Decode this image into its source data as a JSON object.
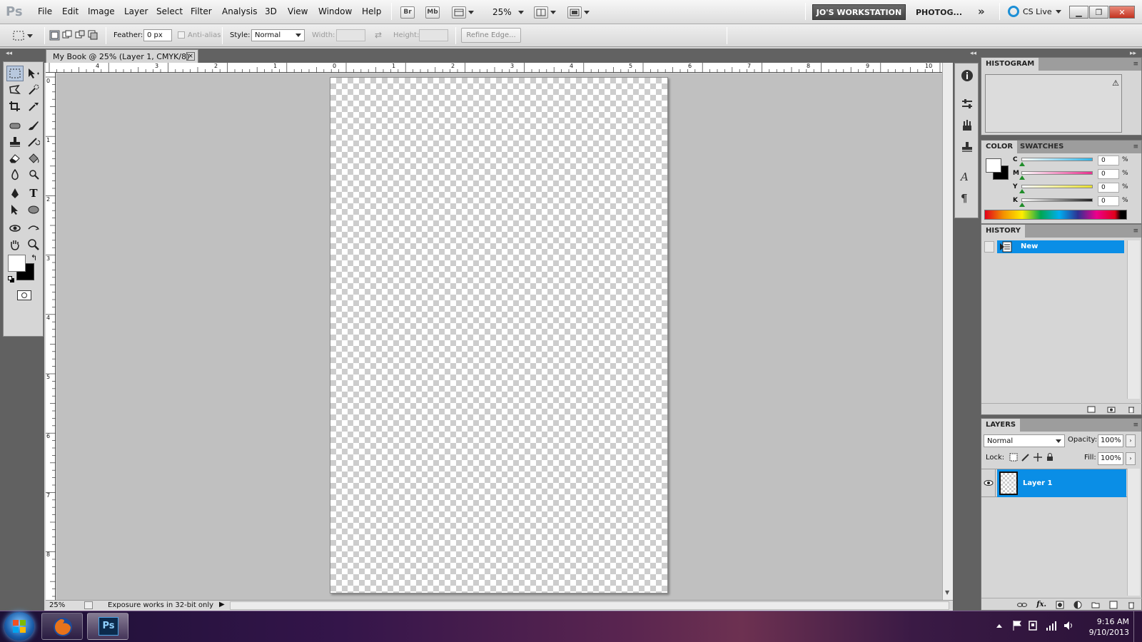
{
  "menubar": {
    "app_icon": "Ps",
    "items": [
      "File",
      "Edit",
      "Image",
      "Layer",
      "Select",
      "Filter",
      "Analysis",
      "3D",
      "View",
      "Window",
      "Help"
    ],
    "bridge_label": "Br",
    "minibridge_label": "Mb",
    "zoom": "25%",
    "workspace": "JO'S WORKSTATION",
    "workspace_alt": "PHOTOG...",
    "more": "»",
    "cs_live": "CS Live"
  },
  "options": {
    "feather_label": "Feather:",
    "feather_value": "0 px",
    "antialias_label": "Anti-alias",
    "style_label": "Style:",
    "style_value": "Normal",
    "width_label": "Width:",
    "height_label": "Height:",
    "refine_edge": "Refine Edge..."
  },
  "document": {
    "tab_title": "My Book @ 25% (Layer 1, CMYK/8)",
    "close_glyph": "×",
    "ruler_h_labels": [
      "4",
      "3",
      "2",
      "1",
      "0",
      "1",
      "2",
      "3",
      "4",
      "5",
      "6",
      "7",
      "8",
      "9",
      "10"
    ],
    "ruler_v_labels": [
      "0",
      "1",
      "2",
      "3",
      "4",
      "5",
      "6",
      "7",
      "8"
    ]
  },
  "status": {
    "zoom": "25%",
    "message": "Exposure works in 32-bit only"
  },
  "panels": {
    "histogram": {
      "title": "HISTOGRAM",
      "warning": "⚠"
    },
    "color": {
      "tabs": [
        "COLOR",
        "SWATCHES"
      ],
      "channels": [
        {
          "label": "C",
          "value": "0",
          "pct": "%",
          "color": "#2fb5e8"
        },
        {
          "label": "M",
          "value": "0",
          "pct": "%",
          "color": "#e8318f"
        },
        {
          "label": "Y",
          "value": "0",
          "pct": "%",
          "color": "#e8e02f"
        },
        {
          "label": "K",
          "value": "0",
          "pct": "%",
          "color": "#222222"
        }
      ]
    },
    "history": {
      "title": "HISTORY",
      "items": [
        "New"
      ]
    },
    "layers": {
      "title": "LAYERS",
      "blend_mode": "Normal",
      "opacity_label": "Opacity:",
      "opacity_value": "100%",
      "lock_label": "Lock:",
      "fill_label": "Fill:",
      "fill_value": "100%",
      "items": [
        {
          "name": "Layer 1",
          "visible": true
        }
      ],
      "footer_fx": "fx."
    }
  },
  "taskbar": {
    "time": "9:16 AM",
    "date": "9/10/2013",
    "ps_label": "Ps"
  },
  "colors": {
    "selection_blue": "#0a8ee6",
    "panel_gray": "#d6d6d6",
    "frame_gray": "#626262"
  }
}
